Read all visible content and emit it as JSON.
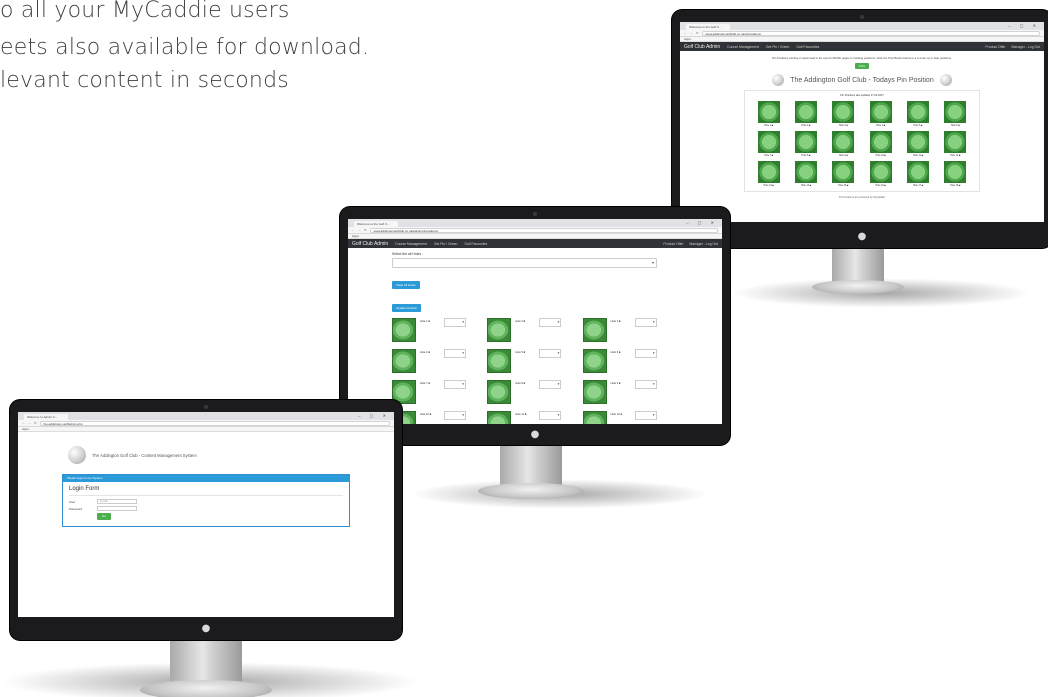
{
  "promo": {
    "line1": "o all your MyCaddie users",
    "line2": "eets also available for download.",
    "line3": "levant content in seconds"
  },
  "monitor_login": {
    "tab_title": "Welcome to Admin C...",
    "url": "the-addington-golf/admin.php",
    "apps_label": "Apps",
    "header_title": "The Addington Golf Club - Content Management System",
    "panel_title": "Please login to our System",
    "form_title": "Login Form",
    "user_label": "User",
    "user_placeholder": "E-mail",
    "password_label": "Password",
    "go_label": "Go",
    "apple_logo": "apple-logo"
  },
  "monitor_holes": {
    "tab_title": "Welcome to the Golf C...",
    "url": "www.addingtongolfclub.co.uk/admin/pinpositions",
    "apps_label": "Apps",
    "brand": "Golf Club Admin",
    "nav": [
      "Course Management",
      "Get Pin / Green",
      "Golf Favourites"
    ],
    "nav_right": [
      "Product Offer",
      "Manager - Log Out"
    ],
    "select_label": "Select the all Holes :",
    "clear_button": "Clear All Holes",
    "update_button": "Update Position",
    "col_heads": [
      "Hole",
      "Position",
      "Hole",
      "Position",
      "Hole",
      "Position"
    ],
    "holes": [
      "Hole 1 ■",
      "Hole 2 ■",
      "Hole 3 ■",
      "Hole 4 ■",
      "Hole 5 ■",
      "Hole 6 ■",
      "Hole 7 ■",
      "Hole 8 ■",
      "Hole 9 ■",
      "Hole 10 ■",
      "Hole 11 ■",
      "Hole 12 ■"
    ],
    "apple_logo": "apple-logo"
  },
  "monitor_pins": {
    "tab_title": "Welcome to the Golf C...",
    "url": "www.addingtongolfclub.co.uk/pinpositions",
    "apps_label": "Apps",
    "brand": "Golf Club Admin",
    "nav": [
      "Course Management",
      "Get Pin / Green",
      "Golf Favourites"
    ],
    "nav_right": [
      "Product Offer",
      "Manager - Log Out"
    ],
    "info_text": "Pin Positions printing 2 supervised in the used to BAND pages to tracking positions. Click the Print Button below to a to scan up to date positions.",
    "print_button": "Print",
    "title": "The Addington Golf Club - Todays Pin Position",
    "subtitle": "Pin Positions last updated 17.02.2017",
    "pins": [
      "Hole 1 ■",
      "Hole 2 ■",
      "Hole 3 ■",
      "Hole 4 ■",
      "Hole 5 ■",
      "Hole 6 ■",
      "Hole 7 ■",
      "Hole 8 ■",
      "Hole 9 ■",
      "Hole 10 ■",
      "Hole 11 ■",
      "Hole 12 ■",
      "Hole 13 ■",
      "Hole 14 ■",
      "Hole 15 ■",
      "Hole 16 ■",
      "Hole 17 ■",
      "Hole 18 ■"
    ],
    "footer": "Pin Positions are powered by MyCaddie",
    "apple_logo": "apple-logo"
  }
}
